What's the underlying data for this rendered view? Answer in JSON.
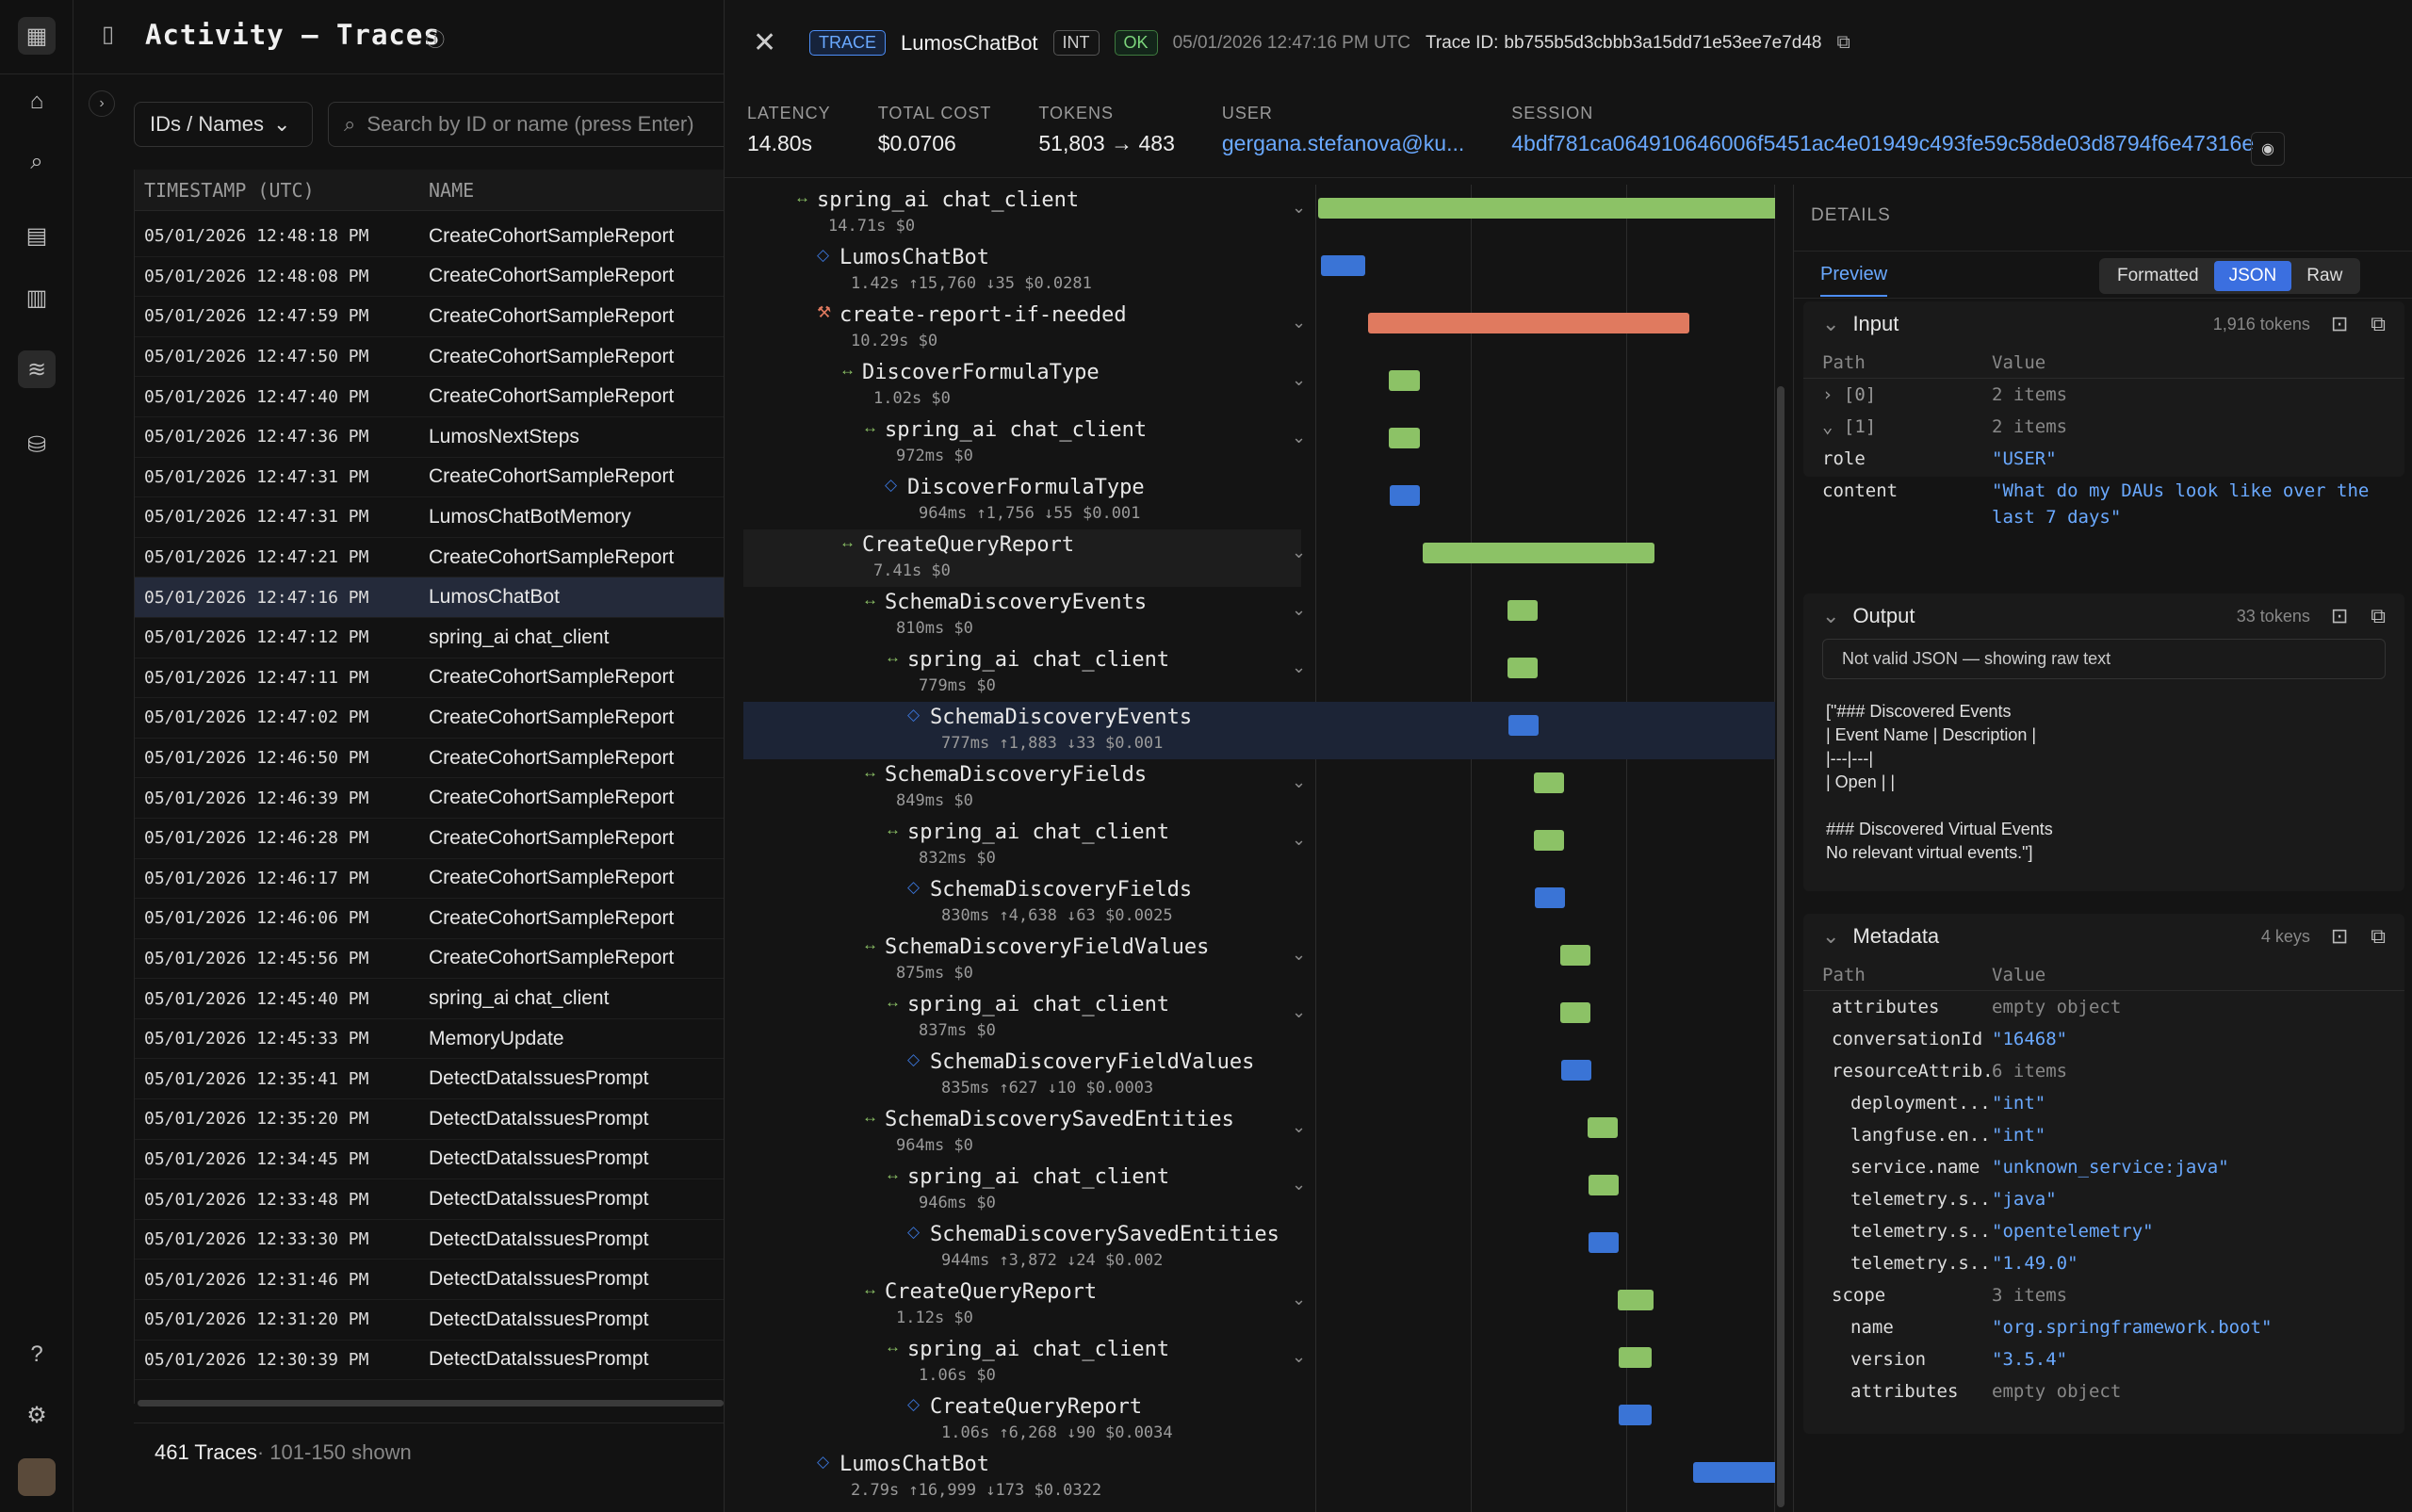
{
  "app": {
    "title": "Activity – Traces"
  },
  "filters": {
    "id_select": "IDs / Names",
    "search_placeholder": "Search by ID or name (press Enter)"
  },
  "table": {
    "columns": [
      "TIMESTAMP (UTC)",
      "NAME"
    ],
    "rows": [
      [
        "05/01/2026 12:48:18 PM",
        "CreateCohortSampleReport"
      ],
      [
        "05/01/2026 12:48:08 PM",
        "CreateCohortSampleReport"
      ],
      [
        "05/01/2026 12:47:59 PM",
        "CreateCohortSampleReport"
      ],
      [
        "05/01/2026 12:47:50 PM",
        "CreateCohortSampleReport"
      ],
      [
        "05/01/2026 12:47:40 PM",
        "CreateCohortSampleReport"
      ],
      [
        "05/01/2026 12:47:36 PM",
        "LumosNextSteps"
      ],
      [
        "05/01/2026 12:47:31 PM",
        "CreateCohortSampleReport"
      ],
      [
        "05/01/2026 12:47:31 PM",
        "LumosChatBotMemory"
      ],
      [
        "05/01/2026 12:47:21 PM",
        "CreateCohortSampleReport"
      ],
      [
        "05/01/2026 12:47:16 PM",
        "LumosChatBot"
      ],
      [
        "05/01/2026 12:47:12 PM",
        "spring_ai chat_client"
      ],
      [
        "05/01/2026 12:47:11 PM",
        "CreateCohortSampleReport"
      ],
      [
        "05/01/2026 12:47:02 PM",
        "CreateCohortSampleReport"
      ],
      [
        "05/01/2026 12:46:50 PM",
        "CreateCohortSampleReport"
      ],
      [
        "05/01/2026 12:46:39 PM",
        "CreateCohortSampleReport"
      ],
      [
        "05/01/2026 12:46:28 PM",
        "CreateCohortSampleReport"
      ],
      [
        "05/01/2026 12:46:17 PM",
        "CreateCohortSampleReport"
      ],
      [
        "05/01/2026 12:46:06 PM",
        "CreateCohortSampleReport"
      ],
      [
        "05/01/2026 12:45:56 PM",
        "CreateCohortSampleReport"
      ],
      [
        "05/01/2026 12:45:40 PM",
        "spring_ai chat_client"
      ],
      [
        "05/01/2026 12:45:33 PM",
        "MemoryUpdate"
      ],
      [
        "05/01/2026 12:35:41 PM",
        "DetectDataIssuesPrompt"
      ],
      [
        "05/01/2026 12:35:20 PM",
        "DetectDataIssuesPrompt"
      ],
      [
        "05/01/2026 12:34:45 PM",
        "DetectDataIssuesPrompt"
      ],
      [
        "05/01/2026 12:33:48 PM",
        "DetectDataIssuesPrompt"
      ],
      [
        "05/01/2026 12:33:30 PM",
        "DetectDataIssuesPrompt"
      ],
      [
        "05/01/2026 12:31:46 PM",
        "DetectDataIssuesPrompt"
      ],
      [
        "05/01/2026 12:31:20 PM",
        "DetectDataIssuesPrompt"
      ],
      [
        "05/01/2026 12:30:39 PM",
        "DetectDataIssuesPrompt"
      ]
    ],
    "selected_index": 9,
    "footer_count": "461 Traces",
    "footer_shown": " · 101-150 shown"
  },
  "trace": {
    "type_badge": "TRACE",
    "name": "LumosChatBot",
    "env_badge": "INT",
    "status_badge": "OK",
    "timestamp": "05/01/2026 12:47:16 PM UTC",
    "trace_id_label": "Trace ID:",
    "trace_id": "bb755b5d3cbbb3a15dd71e53ee7e7d48"
  },
  "metrics": [
    {
      "label": "LATENCY",
      "value": "14.80s"
    },
    {
      "label": "TOTAL COST",
      "value": "$0.0706"
    },
    {
      "label": "TOKENS",
      "value": "51,803 → 483"
    },
    {
      "label": "USER",
      "value": "gergana.stefanova@ku..."
    },
    {
      "label": "SESSION",
      "value": "4bdf781ca064910646006f5451ac4e01949c493fe59c58de03d8794f6e47316e"
    }
  ],
  "tree": [
    {
      "name": "spring_ai chat_client",
      "sub": "14.71s $0",
      "kind": "chain",
      "chev": true,
      "start": 0,
      "dur": 14.71
    },
    {
      "name": "LumosChatBot",
      "sub": "1.42s ↑15,760 ↓35 $0.0281",
      "kind": "gen",
      "chev": false,
      "start": 0.09,
      "dur": 1.42
    },
    {
      "name": "create-report-if-needed",
      "sub": "10.29s $0",
      "kind": "tool",
      "chev": true,
      "start": 1.6,
      "dur": 10.29
    },
    {
      "name": "DiscoverFormulaType",
      "sub": "1.02s $0",
      "kind": "chain",
      "chev": true,
      "start": 2.25,
      "dur": 1.02
    },
    {
      "name": "spring_ai chat_client",
      "sub": "972ms $0",
      "kind": "chain",
      "chev": true,
      "start": 2.27,
      "dur": 0.972
    },
    {
      "name": "DiscoverFormulaType",
      "sub": "964ms ↑1,756 ↓55 $0.001",
      "kind": "gen",
      "chev": false,
      "start": 2.28,
      "dur": 0.964
    },
    {
      "name": "CreateQueryReport",
      "sub": "7.41s $0",
      "kind": "chain",
      "chev": true,
      "start": 3.35,
      "dur": 7.41,
      "hl": true
    },
    {
      "name": "SchemaDiscoveryEvents",
      "sub": "810ms $0",
      "kind": "chain",
      "chev": true,
      "start": 6.05,
      "dur": 0.81
    },
    {
      "name": "spring_ai chat_client",
      "sub": "779ms $0",
      "kind": "chain",
      "chev": true,
      "start": 6.07,
      "dur": 0.779
    },
    {
      "name": "SchemaDiscoveryEvents",
      "sub": "777ms ↑1,883 ↓33 $0.001",
      "kind": "gen",
      "chev": false,
      "start": 6.08,
      "dur": 0.777,
      "sel": true
    },
    {
      "name": "SchemaDiscoveryFields",
      "sub": "849ms $0",
      "kind": "chain",
      "chev": true,
      "start": 6.9,
      "dur": 0.849
    },
    {
      "name": "spring_ai chat_client",
      "sub": "832ms $0",
      "kind": "chain",
      "chev": true,
      "start": 6.91,
      "dur": 0.832
    },
    {
      "name": "SchemaDiscoveryFields",
      "sub": "830ms ↑4,638 ↓63 $0.0025",
      "kind": "gen",
      "chev": false,
      "start": 6.92,
      "dur": 0.83
    },
    {
      "name": "SchemaDiscoveryFieldValues",
      "sub": "875ms $0",
      "kind": "chain",
      "chev": true,
      "start": 7.75,
      "dur": 0.875
    },
    {
      "name": "spring_ai chat_client",
      "sub": "837ms $0",
      "kind": "chain",
      "chev": true,
      "start": 7.76,
      "dur": 0.837
    },
    {
      "name": "SchemaDiscoveryFieldValues",
      "sub": "835ms ↑627 ↓10 $0.0003",
      "kind": "gen",
      "chev": false,
      "start": 7.77,
      "dur": 0.835
    },
    {
      "name": "SchemaDiscoverySavedEntities",
      "sub": "964ms $0",
      "kind": "chain",
      "chev": true,
      "start": 8.63,
      "dur": 0.964
    },
    {
      "name": "spring_ai chat_client",
      "sub": "946ms $0",
      "kind": "chain",
      "chev": true,
      "start": 8.64,
      "dur": 0.946
    },
    {
      "name": "SchemaDiscoverySavedEntities",
      "sub": "944ms ↑3,872 ↓24 $0.002",
      "kind": "gen",
      "chev": false,
      "start": 8.65,
      "dur": 0.944
    },
    {
      "name": "CreateQueryReport",
      "sub": "1.12s $0",
      "kind": "chain",
      "chev": true,
      "start": 9.6,
      "dur": 1.12
    },
    {
      "name": "spring_ai chat_client",
      "sub": "1.06s $0",
      "kind": "chain",
      "chev": true,
      "start": 9.61,
      "dur": 1.06
    },
    {
      "name": "CreateQueryReport",
      "sub": "1.06s ↑6,268 ↓90 $0.0034",
      "kind": "gen",
      "chev": false,
      "start": 9.62,
      "dur": 1.06
    },
    {
      "name": "LumosChatBot",
      "sub": "2.79s ↑16,999 ↓173 $0.0322",
      "kind": "gen",
      "chev": false,
      "start": 12.0,
      "dur": 2.79
    }
  ],
  "tree_indent": [
    1,
    2,
    2,
    3,
    4,
    5,
    3,
    4,
    5,
    6,
    4,
    5,
    6,
    4,
    5,
    6,
    4,
    5,
    6,
    4,
    5,
    6,
    2
  ],
  "details": {
    "title": "DETAILS",
    "tab": "Preview",
    "formats": [
      "Formatted",
      "JSON",
      "Raw"
    ],
    "active_format": "JSON",
    "input": {
      "title": "Input",
      "tokens": "1,916 tokens",
      "path_h": "Path",
      "value_h": "Value",
      "rows": [
        {
          "k": "[0]",
          "v": "2 items",
          "g": true
        },
        {
          "k": "[1]",
          "v": "2 items",
          "g": true
        },
        {
          "k": "role",
          "v": "\"USER\""
        },
        {
          "k": "content",
          "v": "\"What do my DAUs look like over the",
          "v2": "last 7 days\""
        }
      ]
    },
    "output": {
      "title": "Output",
      "tokens": "33 tokens",
      "warn": "Not valid JSON — showing raw text",
      "lines": [
        "[\"### Discovered Events",
        "| Event Name | Description |",
        "|---|---|",
        "| Open |  |",
        "",
        "### Discovered Virtual Events",
        "No relevant virtual events.\"]"
      ]
    },
    "metadata": {
      "title": "Metadata",
      "keys": "4 keys",
      "path_h": "Path",
      "value_h": "Value",
      "rows": [
        {
          "k": "attributes",
          "v": "empty object",
          "g": true
        },
        {
          "k": "conversationId",
          "v": "\"16468\""
        },
        {
          "k": "resourceAttrib...",
          "v": "6 items",
          "g": true
        },
        {
          "k": "deployment....",
          "v": "\"int\"",
          "i": 1
        },
        {
          "k": "langfuse.en...",
          "v": "\"int\"",
          "i": 1
        },
        {
          "k": "service.name",
          "v": "\"unknown_service:java\"",
          "i": 1
        },
        {
          "k": "telemetry.s...",
          "v": "\"java\"",
          "i": 1
        },
        {
          "k": "telemetry.s...",
          "v": "\"opentelemetry\"",
          "i": 1
        },
        {
          "k": "telemetry.s...",
          "v": "\"1.49.0\"",
          "i": 1
        },
        {
          "k": "scope",
          "v": "3 items",
          "g": true
        },
        {
          "k": "name",
          "v": "\"org.springframework.boot\"",
          "i": 1
        },
        {
          "k": "version",
          "v": "\"3.5.4\"",
          "i": 1
        },
        {
          "k": "attributes",
          "v": "empty object",
          "g": true,
          "i": 1
        }
      ]
    }
  },
  "colors": {
    "chain": "#8cc266",
    "gen": "#3a74d6",
    "tool": "#e07a5f",
    "accent": "#4d8ef7"
  }
}
